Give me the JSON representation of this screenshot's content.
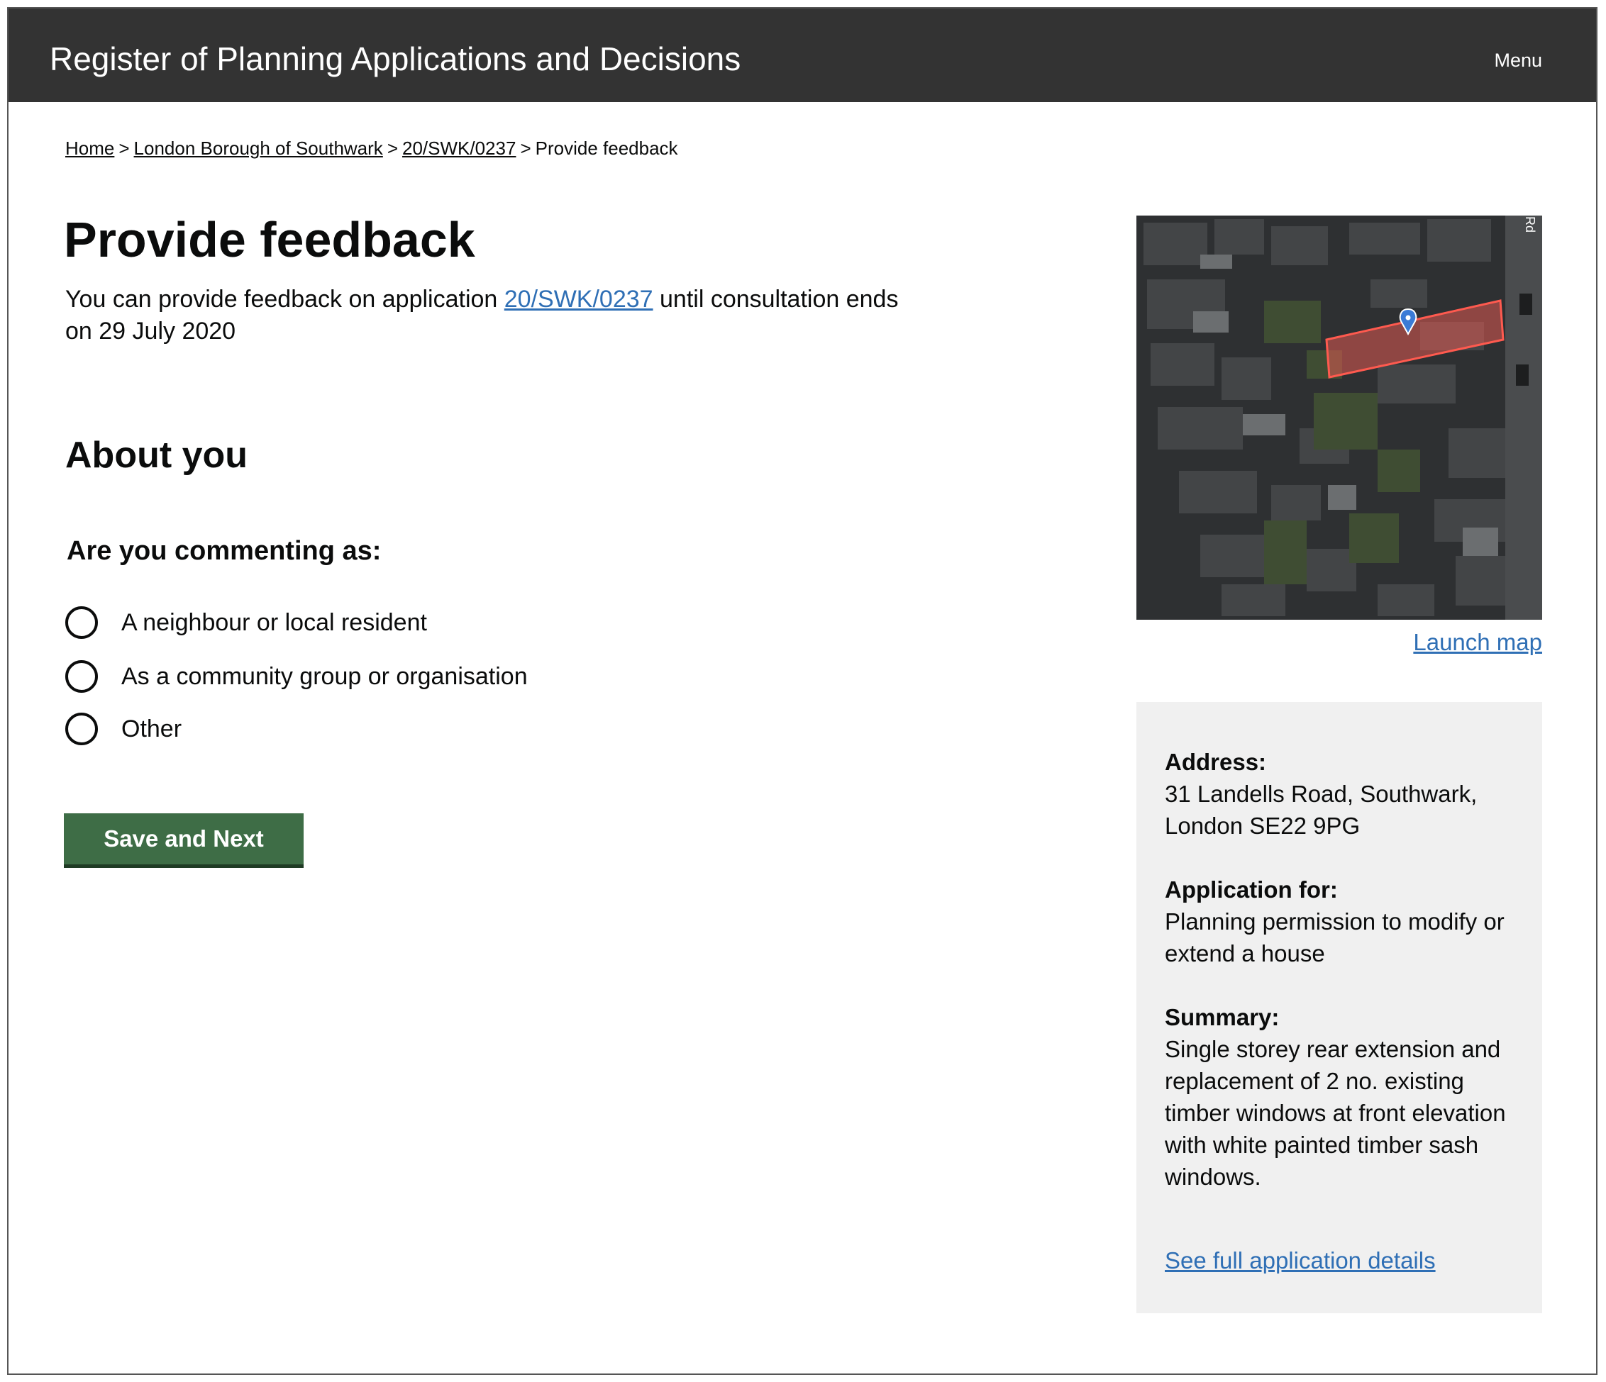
{
  "header": {
    "title": "Register of Planning Applications and Decisions",
    "menu_label": "Menu"
  },
  "breadcrumb": {
    "items": [
      {
        "label": "Home",
        "link": true
      },
      {
        "label": "London Borough of Southwark",
        "link": true
      },
      {
        "label": "20/SWK/0237",
        "link": true
      },
      {
        "label": "Provide feedback",
        "link": false
      }
    ],
    "separator": ">"
  },
  "page": {
    "title": "Provide feedback",
    "intro_before": "You can provide feedback on application ",
    "intro_link": "20/SWK/0237",
    "intro_after": " until consultation ends on 29 July 2020"
  },
  "about": {
    "heading": "About you",
    "question": "Are you commenting as:",
    "options": [
      {
        "label": "A neighbour or local resident",
        "selected": false
      },
      {
        "label": "As a community group or organisation",
        "selected": false
      },
      {
        "label": "Other",
        "selected": false
      }
    ],
    "submit_label": "Save and Next"
  },
  "map": {
    "launch_label": "Launch map",
    "road_label": "Rd"
  },
  "info_panel": {
    "address_label": "Address:",
    "address_value": "31 Landells Road, Southwark, London SE22 9PG",
    "application_label": "Application for:",
    "application_value": "Planning permission to modify or extend a house",
    "summary_label": "Summary:",
    "summary_value": "Single storey rear extension and replacement of 2 no. existing timber windows at front elevation with white painted timber sash windows.",
    "details_link": "See full application details"
  },
  "colors": {
    "header_bg": "#333333",
    "link": "#2f6fb5",
    "button_bg": "#3e6d46",
    "panel_bg": "#f0f0f0",
    "site_outline": "#e05a52"
  }
}
